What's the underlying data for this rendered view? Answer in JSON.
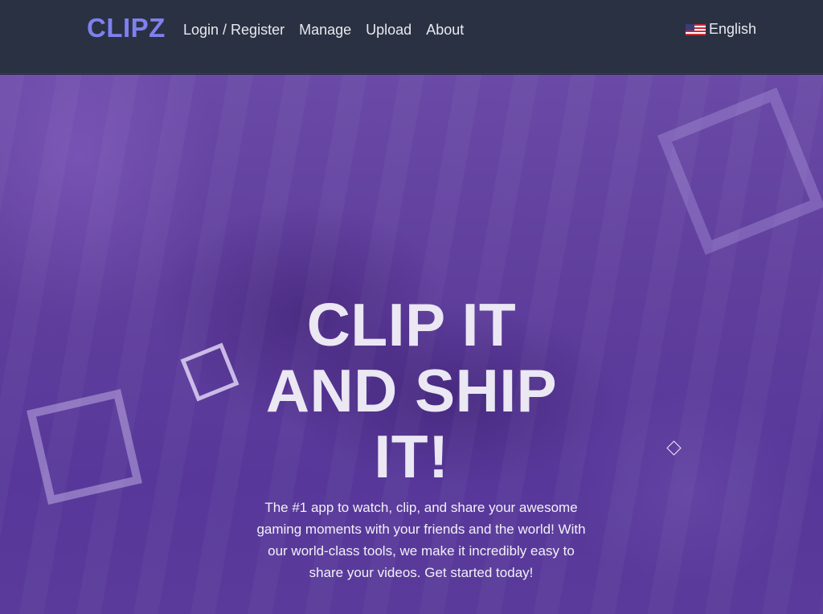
{
  "nav": {
    "logo": "CLIPZ",
    "links": [
      "Login / Register",
      "Manage",
      "Upload",
      "About"
    ],
    "language": "English",
    "flag_icon": "us-flag-icon"
  },
  "hero": {
    "headline": "CLIP IT AND SHIP IT!",
    "tagline": "The #1 app to watch, clip, and share your awesome gaming moments with your friends and the world! With our world-class tools, we make it incredibly easy to share your videos. Get started today!"
  },
  "colors": {
    "navbar": "#2a3142",
    "logo": "#7f80f0",
    "hero_purple": "#5f3e9c",
    "text": "#ebe7f3"
  }
}
